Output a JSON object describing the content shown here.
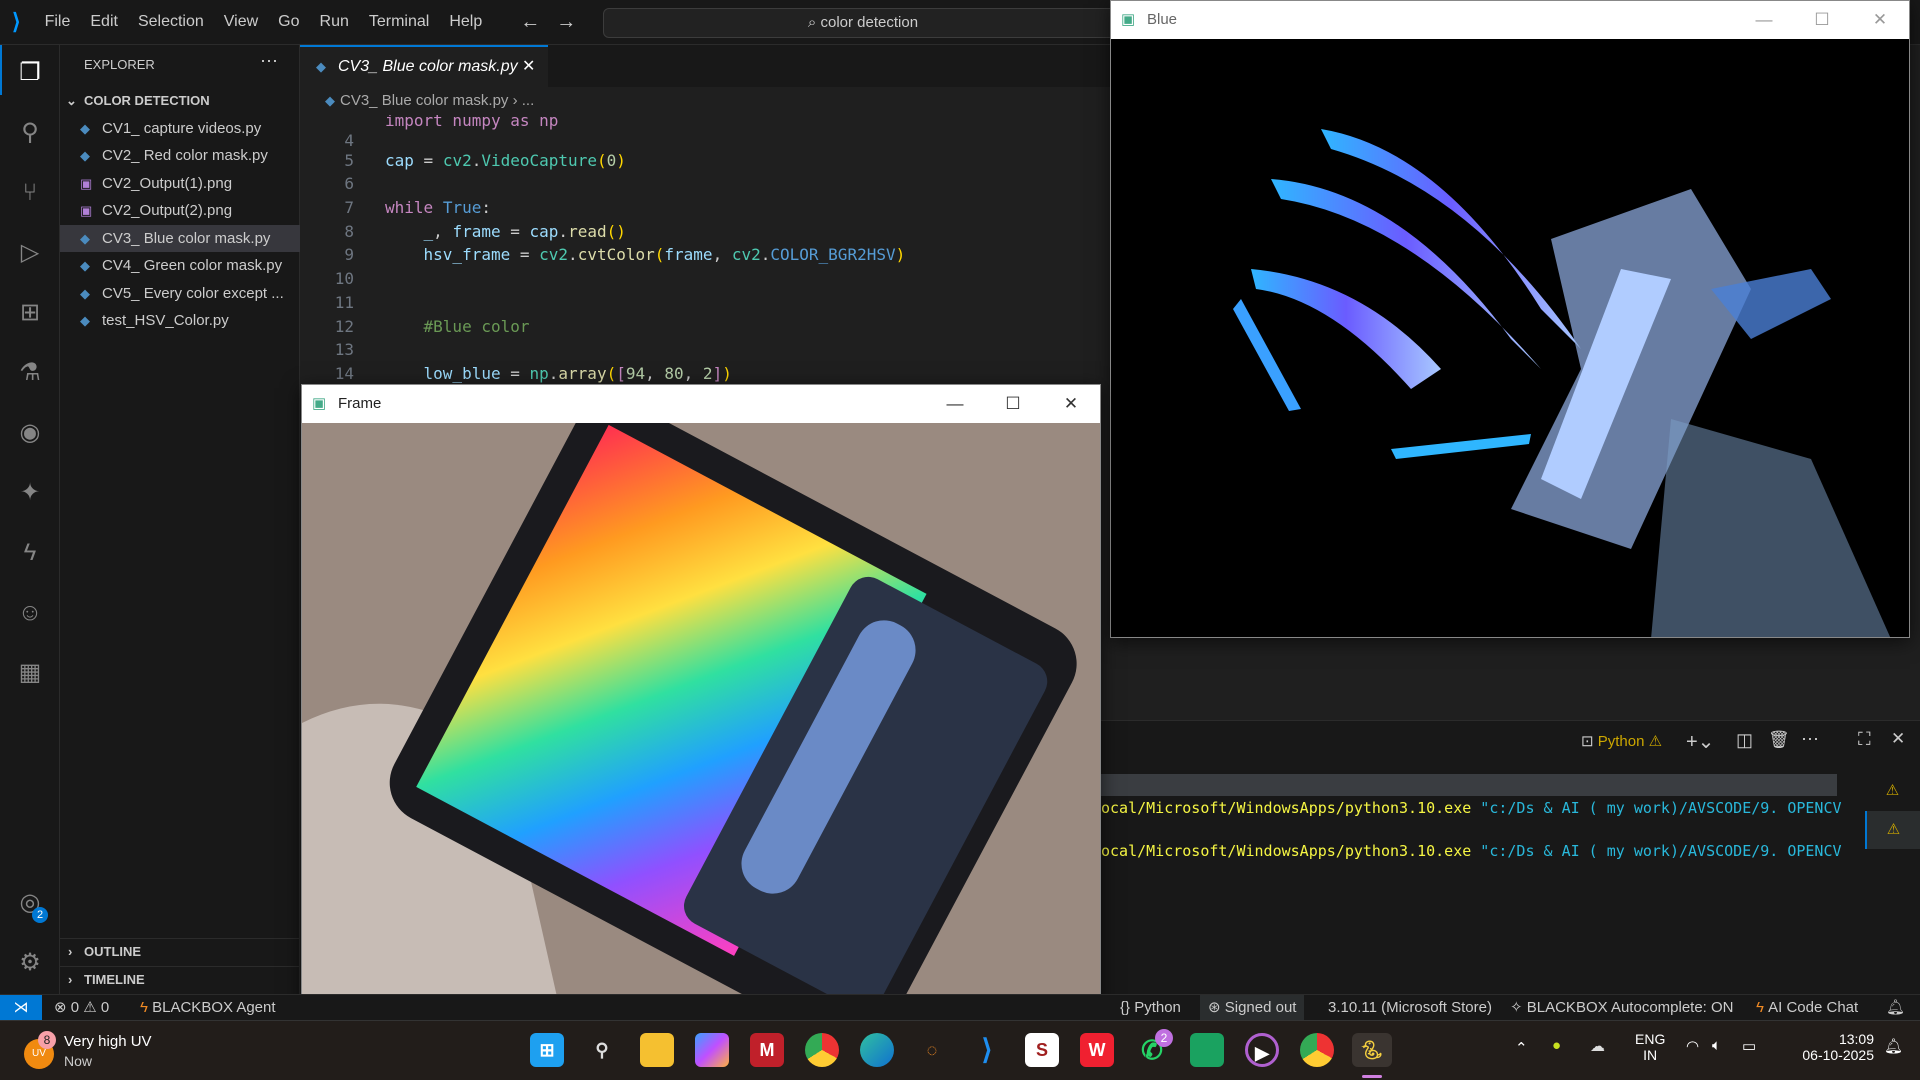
{
  "menu": [
    "File",
    "Edit",
    "Selection",
    "View",
    "Go",
    "Run",
    "Terminal",
    "Help"
  ],
  "search": "color detection",
  "explorer": {
    "title": "EXPLORER",
    "folder": "COLOR DETECTION",
    "files": [
      "CV1_ capture videos.py",
      "CV2_ Red color mask.py",
      "CV2_Output(1).png",
      "CV2_Output(2).png",
      "CV3_ Blue color mask.py",
      "CV4_ Green color mask.py",
      "CV5_ Every color except ...",
      "test_HSV_Color.py"
    ],
    "outline": "OUTLINE",
    "timeline": "TIMELINE"
  },
  "account_badge": "2",
  "tab": {
    "label": "CV3_ Blue color mask.py"
  },
  "breadcrumb": {
    "file": "CV3_ Blue color mask.py",
    "rest": "..."
  },
  "code": {
    "partial": "import numpy as np",
    "line_numbers": [
      "4",
      "5",
      "6",
      "7",
      "8",
      "9",
      "10",
      "11",
      "12",
      "13",
      "14"
    ]
  },
  "blue_window": {
    "title": "Blue"
  },
  "frame_window": {
    "title": "Frame"
  },
  "terminal": {
    "profile": "Python",
    "lines": [
      {
        "path": "ocal/Microsoft/WindowsApps/python3.10.exe",
        "arg": "\"c:/Ds & AI ( my work)/AVSCODE/9. OPENCV"
      },
      {
        "path": "ocal/Microsoft/WindowsApps/python3.10.exe",
        "arg": "\"c:/Ds & AI ( my work)/AVSCODE/9. OPENCV"
      }
    ]
  },
  "status": {
    "errors": "0",
    "warnings": "0",
    "blackbox_agent": "BLACKBOX Agent",
    "language": "Python",
    "signed": "Signed out",
    "interpreter": "3.10.11 (Microsoft Store)",
    "autocomplete": "BLACKBOX Autocomplete: ON",
    "chat": "AI Code Chat"
  },
  "taskbar": {
    "weather_title": "Very high UV",
    "weather_sub": "Now",
    "weather_badge": "8",
    "weather_icon_text": "UV",
    "whatsapp_badge": "2",
    "lang1": "ENG",
    "lang2": "IN",
    "time": "13:09",
    "date": "06-10-2025"
  }
}
